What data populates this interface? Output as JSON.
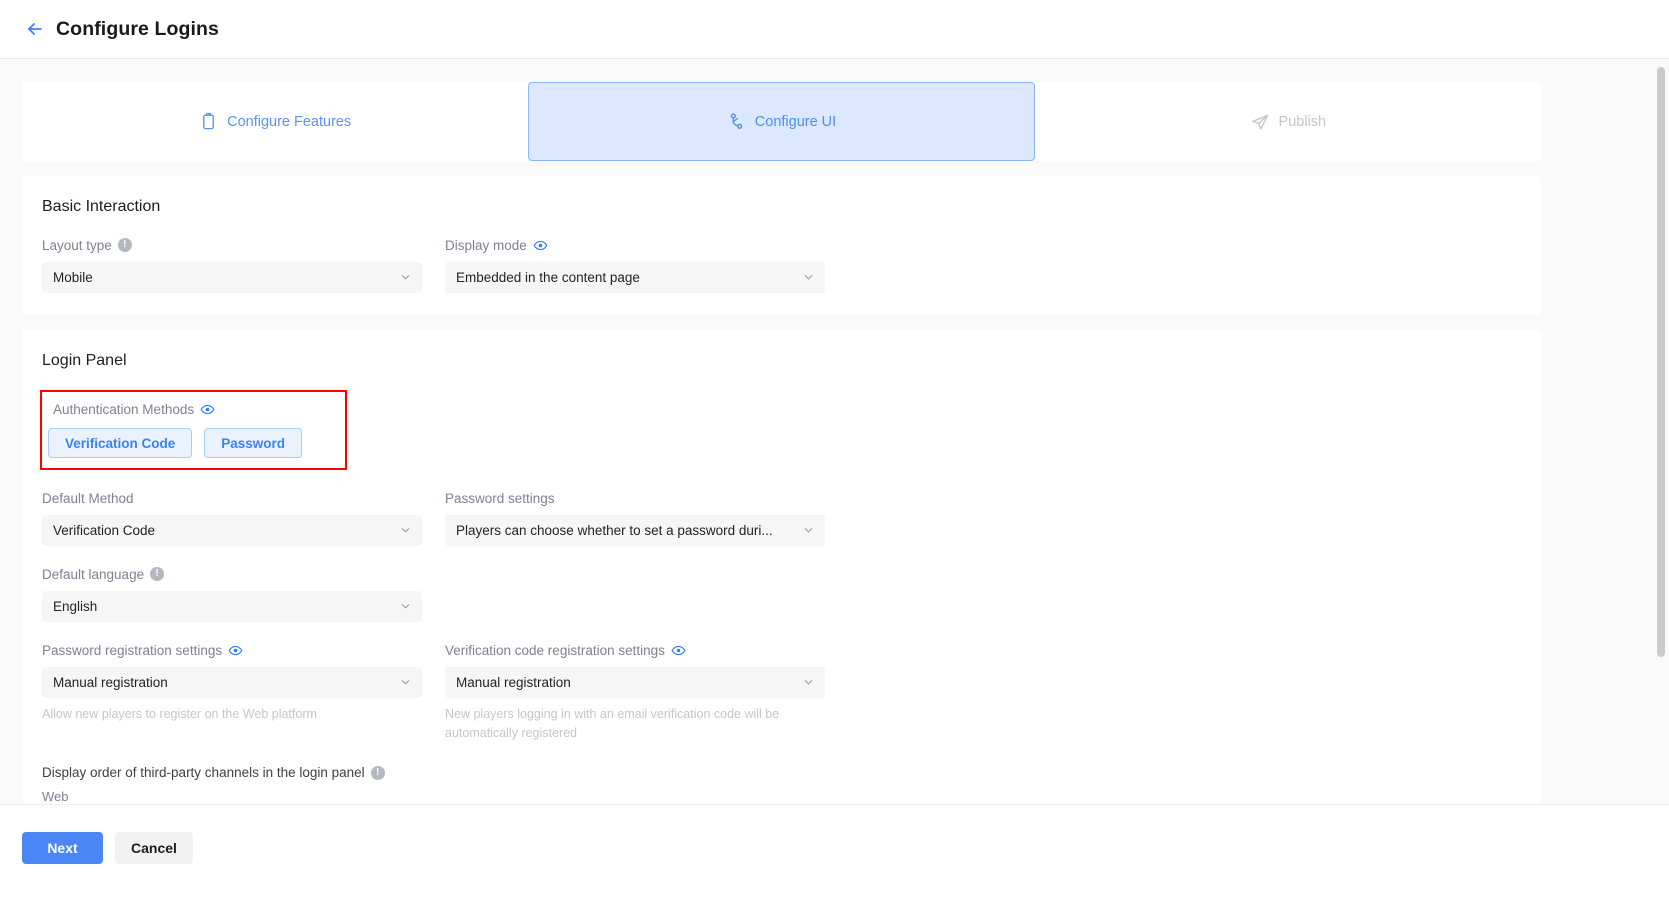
{
  "header": {
    "title": "Configure Logins",
    "back_icon": "arrow-left-icon"
  },
  "steps": [
    {
      "label": "Configure Features",
      "icon": "clipboard-icon",
      "state": "done"
    },
    {
      "label": "Configure UI",
      "icon": "sitemap-icon",
      "state": "active"
    },
    {
      "label": "Publish",
      "icon": "send-icon",
      "state": "upcoming"
    }
  ],
  "basic_interaction": {
    "title": "Basic Interaction",
    "layout_type": {
      "label": "Layout type",
      "info_icon": "info-icon",
      "value": "Mobile"
    },
    "display_mode": {
      "label": "Display mode",
      "eye_icon": "eye-icon",
      "value": "Embedded in the content page"
    }
  },
  "login_panel": {
    "title": "Login Panel",
    "authentication_methods": {
      "label": "Authentication Methods",
      "eye_icon": "eye-icon",
      "chips": [
        "Verification Code",
        "Password"
      ]
    },
    "default_method": {
      "label": "Default Method",
      "value": "Verification Code"
    },
    "password_settings": {
      "label": "Password settings",
      "value": "Players can choose whether to set a password duri..."
    },
    "default_language": {
      "label": "Default language",
      "info_icon": "info-icon",
      "value": "English"
    },
    "password_registration": {
      "label": "Password registration settings",
      "eye_icon": "eye-icon",
      "value": "Manual registration",
      "help": "Allow new players to register on the Web platform"
    },
    "verification_registration": {
      "label": "Verification code registration settings",
      "eye_icon": "eye-icon",
      "value": "Manual registration",
      "help": "New players logging in with an email verification code will be automatically registered"
    },
    "third_party_order": {
      "label": "Display order of third-party channels in the login panel",
      "info_icon": "info-icon",
      "platform": "Web"
    }
  },
  "footer": {
    "next_label": "Next",
    "cancel_label": "Cancel"
  },
  "colors": {
    "accent": "#4a87f5",
    "active_tab_bg": "#dce8fd",
    "highlight": "#fe0000",
    "muted": "#7d8293"
  }
}
